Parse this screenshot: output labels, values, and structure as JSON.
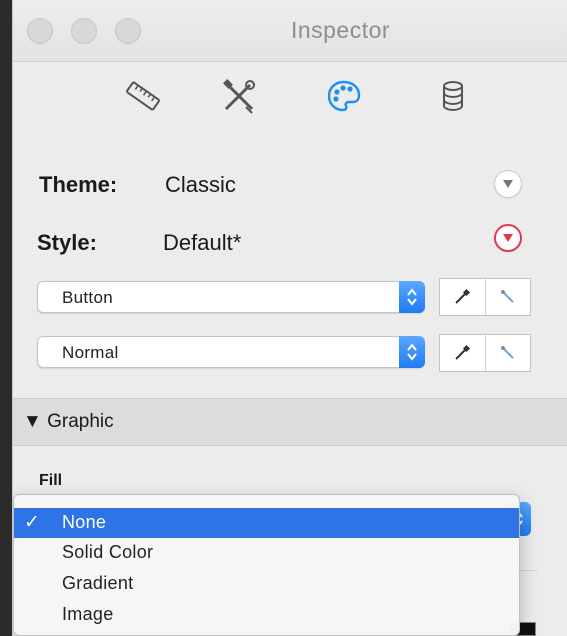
{
  "window": {
    "title": "Inspector"
  },
  "toolbar": {
    "tabs": [
      {
        "icon": "ruler-icon",
        "active": false
      },
      {
        "icon": "tools-icon",
        "active": false
      },
      {
        "icon": "palette-icon",
        "active": true
      },
      {
        "icon": "database-icon",
        "active": false
      }
    ]
  },
  "properties": {
    "theme_label": "Theme:",
    "theme_value": "Classic",
    "style_label": "Style:",
    "style_value": "Default*"
  },
  "selects": {
    "element_value": "Button",
    "state_value": "Normal"
  },
  "graphic": {
    "header": "▼ Graphic",
    "fill_label": "Fill"
  },
  "fill_menu": {
    "items": [
      {
        "label": "None",
        "selected": true
      },
      {
        "label": "Solid Color",
        "selected": false
      },
      {
        "label": "Gradient",
        "selected": false
      },
      {
        "label": "Image",
        "selected": false
      }
    ],
    "check_glyph": "✓"
  },
  "colors": {
    "accent": "#2e74e6",
    "active_icon": "#1f8ef1",
    "warning": "#e0394a"
  }
}
